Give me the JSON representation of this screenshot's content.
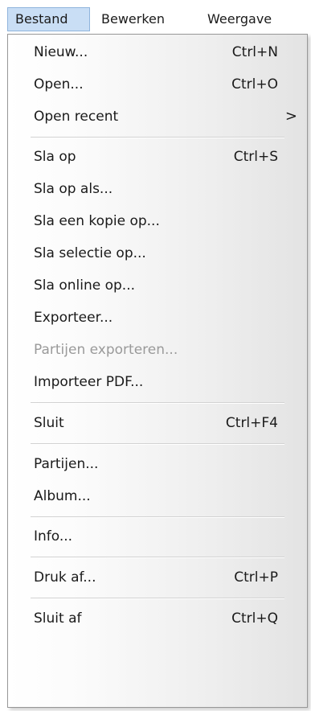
{
  "menubar": {
    "items": [
      {
        "label": "Bestand",
        "active": true
      },
      {
        "label": "Bewerken",
        "active": false
      },
      {
        "label": "Weergave",
        "active": false
      }
    ]
  },
  "menu": {
    "items": [
      {
        "label": "Nieuw...",
        "shortcut": "Ctrl+N"
      },
      {
        "label": "Open...",
        "shortcut": "Ctrl+O"
      },
      {
        "label": "Open recent",
        "submenu_indicator": ">"
      },
      {
        "label": "Sla op",
        "shortcut": "Ctrl+S"
      },
      {
        "label": "Sla op als..."
      },
      {
        "label": "Sla een kopie op..."
      },
      {
        "label": "Sla selectie op..."
      },
      {
        "label": "Sla online op..."
      },
      {
        "label": "Exporteer..."
      },
      {
        "label": "Partijen exporteren...",
        "disabled": true
      },
      {
        "label": "Importeer PDF..."
      },
      {
        "label": "Sluit",
        "shortcut": "Ctrl+F4"
      },
      {
        "label": "Partijen..."
      },
      {
        "label": "Album..."
      },
      {
        "label": "Info..."
      },
      {
        "label": "Druk af...",
        "shortcut": "Ctrl+P"
      },
      {
        "label": "Sluit af",
        "shortcut": "Ctrl+Q"
      }
    ]
  },
  "colors": {
    "active_menubar_bg": "#c9def5",
    "active_menubar_border": "#8fb4dc",
    "disabled_text": "#9a9a9a"
  }
}
